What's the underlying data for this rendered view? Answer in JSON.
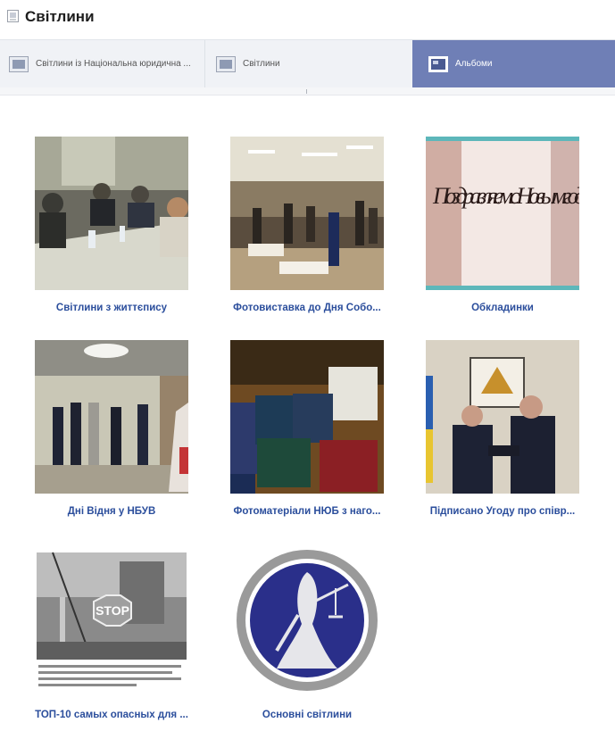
{
  "header": {
    "title": "Світлини"
  },
  "tabs": [
    {
      "label": "Світлини із Національна юридична ...",
      "icon": "photo-icon"
    },
    {
      "label": "Світлини",
      "icon": "photo-icon"
    },
    {
      "label": "Альбоми",
      "icon": "album-icon"
    }
  ],
  "albums": [
    {
      "caption": "Світлини з життєпису"
    },
    {
      "caption": "Фотовиставка до Дня Собо..."
    },
    {
      "caption": "Обкладинки",
      "thumb_text": "Поздравляем с Новым годом и Р"
    },
    {
      "caption": "Дні Відня у НБУВ"
    },
    {
      "caption": "Фотоматеріали НЮБ з наго..."
    },
    {
      "caption": "Підписано Угоду про співр..."
    },
    {
      "caption": "ТОП-10 самых опасных для ...",
      "thumb_text": "STOP"
    },
    {
      "caption": "Основні світлини"
    }
  ],
  "colors": {
    "accent": "#6f7fb6",
    "link": "#2b4e9c"
  }
}
